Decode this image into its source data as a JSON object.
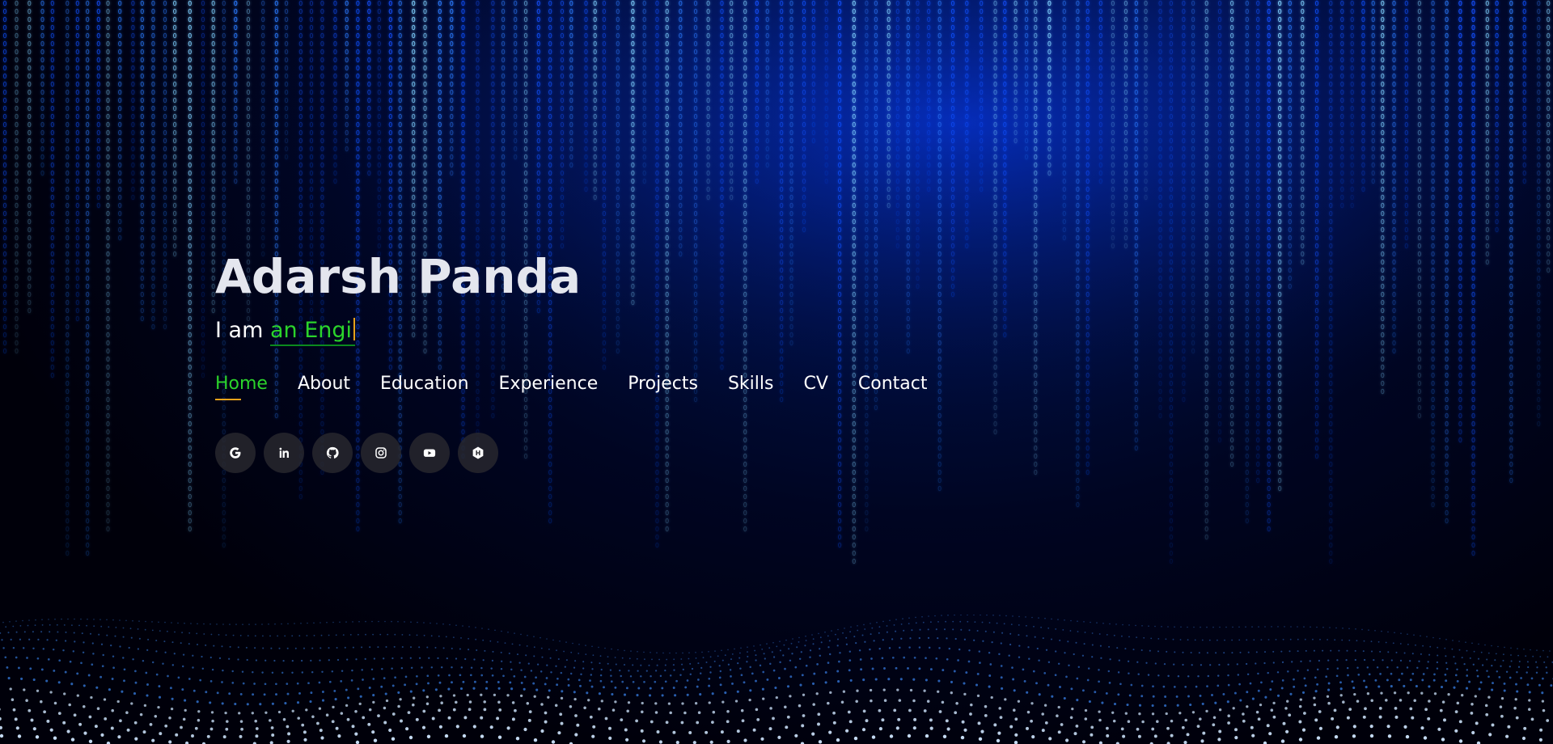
{
  "hero": {
    "name": "Adarsh Panda",
    "tagline_prefix": "I am ",
    "tagline_typed": "an Engi"
  },
  "nav": {
    "items": [
      {
        "label": "Home",
        "active": true
      },
      {
        "label": "About"
      },
      {
        "label": "Education"
      },
      {
        "label": "Experience"
      },
      {
        "label": "Projects"
      },
      {
        "label": "Skills"
      },
      {
        "label": "CV"
      },
      {
        "label": "Contact"
      }
    ]
  },
  "socials": [
    {
      "icon": "google-icon"
    },
    {
      "icon": "linkedin-icon"
    },
    {
      "icon": "github-icon"
    },
    {
      "icon": "instagram-icon"
    },
    {
      "icon": "youtube-icon"
    },
    {
      "icon": "hackerrank-icon"
    }
  ],
  "colors": {
    "accent_green": "#2bd42b",
    "cursor_orange": "#e8a21a",
    "matrix_blue": "#1a6cff"
  }
}
